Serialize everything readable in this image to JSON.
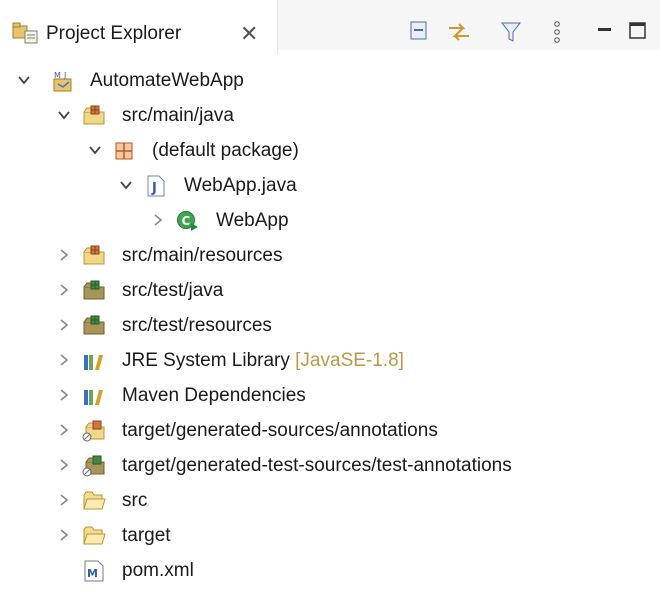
{
  "view": {
    "title": "Project Explorer",
    "close_icon": "close-icon",
    "toolbar": [
      "collapse-all-icon",
      "link-with-editor-icon",
      "filter-icon",
      "view-menu-icon",
      "minimize-icon",
      "maximize-icon"
    ]
  },
  "tree": [
    {
      "label": "AutomateWebApp",
      "icon": "maven-project-icon",
      "expanded": true,
      "depth": 0
    },
    {
      "label": "src/main/java",
      "icon": "source-folder-icon",
      "expanded": true,
      "depth": 1
    },
    {
      "label": "(default package)",
      "icon": "package-icon",
      "expanded": true,
      "depth": 2
    },
    {
      "label": "WebApp.java",
      "icon": "java-file-icon",
      "expanded": true,
      "depth": 3
    },
    {
      "label": "WebApp",
      "icon": "java-class-icon",
      "expanded": false,
      "depth": 4
    },
    {
      "label": "src/main/resources",
      "icon": "source-folder-icon",
      "expanded": false,
      "depth": 1
    },
    {
      "label": "src/test/java",
      "icon": "test-source-folder-icon",
      "expanded": false,
      "depth": 1
    },
    {
      "label": "src/test/resources",
      "icon": "test-source-folder-icon",
      "expanded": false,
      "depth": 1
    },
    {
      "label": "JRE System Library",
      "decoration": "[JavaSE-1.8]",
      "icon": "library-icon",
      "expanded": false,
      "depth": 1
    },
    {
      "label": "Maven Dependencies",
      "icon": "library-icon",
      "expanded": false,
      "depth": 1
    },
    {
      "label": "target/generated-sources/annotations",
      "icon": "generated-source-folder-icon",
      "expanded": false,
      "depth": 1
    },
    {
      "label": "target/generated-test-sources/test-annotations",
      "icon": "generated-test-source-folder-icon",
      "expanded": false,
      "depth": 1
    },
    {
      "label": "src",
      "icon": "folder-icon",
      "expanded": false,
      "depth": 1
    },
    {
      "label": "target",
      "icon": "folder-icon",
      "expanded": false,
      "depth": 1
    },
    {
      "label": "pom.xml",
      "icon": "maven-pom-icon",
      "expanded": null,
      "depth": 1
    }
  ]
}
